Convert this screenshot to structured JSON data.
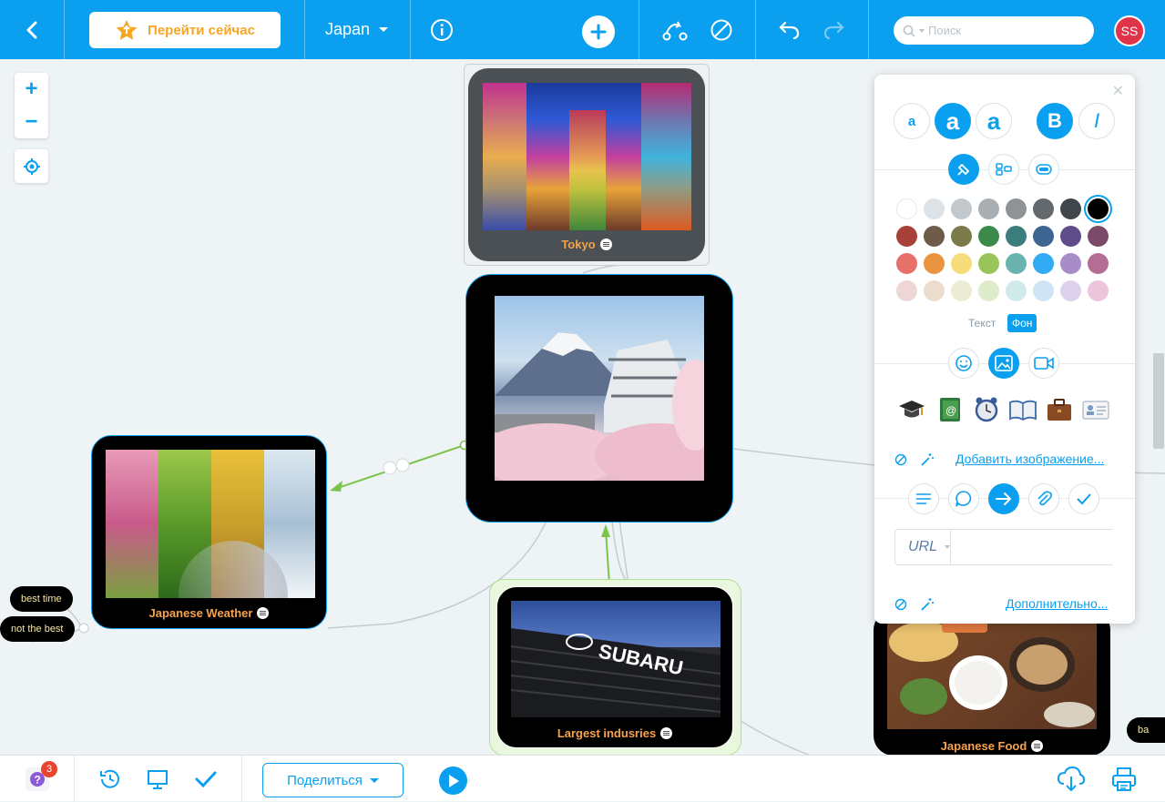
{
  "toolbar": {
    "goto_label": "Перейти сейчас",
    "map_name": "Japan",
    "search_placeholder": "Поиск",
    "user_initials": "SS"
  },
  "nodes": {
    "tokyo": "Tokyo",
    "weather": "Japanese Weather",
    "industries": "Largest indusries",
    "food": "Japanese Food"
  },
  "tags": {
    "best_time": "best time",
    "not_best": "not the best",
    "partial": "ba"
  },
  "panel": {
    "font_small": "a",
    "font_medium": "a",
    "font_large": "a",
    "bold": "B",
    "italic": "I",
    "tab_text": "Текст",
    "tab_background": "Фон",
    "add_image_link": "Добавить изображение...",
    "url_type": "URL",
    "url_value": "",
    "more_link": "Дополнительно...",
    "colors": [
      [
        "#ffffff",
        "#dde2e6",
        "#c2c8cc",
        "#a8aeb2",
        "#8d9397",
        "#62686c",
        "#404649",
        "#000000"
      ],
      [
        "#a8403a",
        "#6e5b48",
        "#7a7a4a",
        "#3b8a4c",
        "#3c7e7e",
        "#3e6492",
        "#5f4c8a",
        "#7a4a68"
      ],
      [
        "#e8706a",
        "#ea9440",
        "#f7dd7a",
        "#98c45a",
        "#6ab4b0",
        "#33aaf4",
        "#a88cc8",
        "#b46e96"
      ],
      [
        "#eed6d6",
        "#ecdccc",
        "#ececd4",
        "#dfeccc",
        "#cfeaea",
        "#cfe4f4",
        "#dcd2ec",
        "#ecc4dc"
      ]
    ],
    "selected_color": "#000000"
  },
  "bottombar": {
    "notifications": "3",
    "share_label": "Поделиться"
  }
}
